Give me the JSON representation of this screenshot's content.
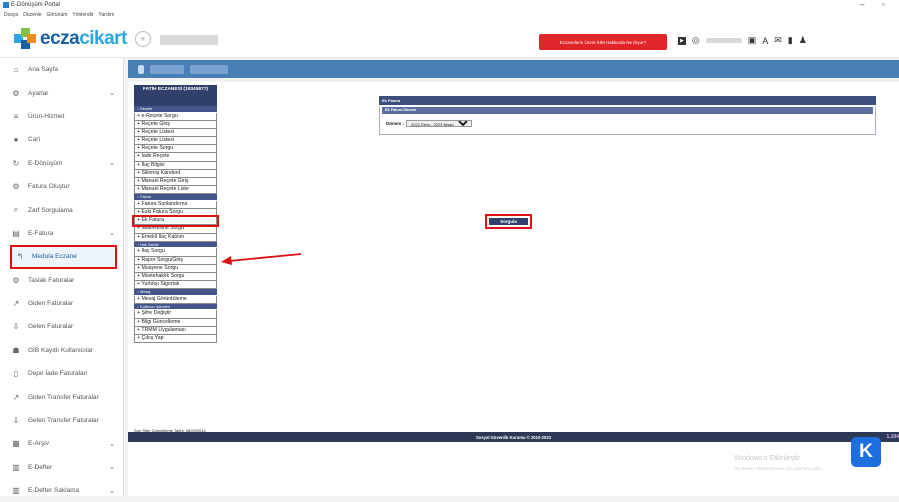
{
  "window": {
    "title": "E-Dönüşüm Portal"
  },
  "menubar": [
    "Dosya",
    "Düzenle",
    "Görünüm",
    "Yönlendir",
    "Yardım"
  ],
  "brand": {
    "name_part1": "ecza",
    "name_part2": "cikart",
    "circle_icon": "plus-circle-icon"
  },
  "alert_button": "Eczanelerin Ücret İHM Hakkında Ne Diyor?",
  "sidebar": [
    {
      "label": "Ana Sayfa",
      "icon": "home-icon"
    },
    {
      "label": "Ayarlar",
      "icon": "gear-icon",
      "chevron": true
    },
    {
      "label": "Ürün-Hizmet",
      "icon": "list-icon"
    },
    {
      "label": "Cari",
      "icon": "user-icon"
    },
    {
      "label": "E-Dönüşüm",
      "icon": "refresh-icon",
      "chevron": true
    },
    {
      "label": "Fatura Oluştur",
      "icon": "gear-icon"
    },
    {
      "label": "Zarf Sorgulama",
      "icon": "search-icon"
    },
    {
      "label": "E-Fatura",
      "icon": "invoice-icon",
      "chevron": true
    },
    {
      "label": "Medula Eczane",
      "icon": "arrow-left-icon",
      "active": true
    },
    {
      "label": "Taslak Faturalar",
      "icon": "gear-icon"
    },
    {
      "label": "Giden Faturalar",
      "icon": "outgoing-icon"
    },
    {
      "label": "Gelen Faturalar",
      "icon": "incoming-icon"
    },
    {
      "label": "GİB Kayıtlı Kullanıcılar",
      "icon": "users-icon"
    },
    {
      "label": "Depo İade Faturaları",
      "icon": "document-icon"
    },
    {
      "label": "Giden Transfer Faturalar",
      "icon": "outgoing-icon"
    },
    {
      "label": "Gelen Transfer Faturalar",
      "icon": "incoming-icon"
    },
    {
      "label": "E-Arşiv",
      "icon": "archive-icon",
      "chevron": true
    },
    {
      "label": "E-Defter",
      "icon": "book-icon",
      "chevron": true
    },
    {
      "label": "E-Defter Saklama",
      "icon": "book-icon",
      "chevron": true
    }
  ],
  "medula": {
    "header": "FATİH ECZANESİ (18345877)",
    "sections": [
      {
        "title": ":: Reçete",
        "links": [
          "+ e-Reçete Sorgu",
          "+ Reçete Giriş",
          "+ Reçete Listesi",
          "+ Reçete Listesi",
          "+ Reçete Sorgu",
          "+ İade Reçete",
          "+ İlaç Bilgisi",
          "+ Silinmiş Karekod",
          "+ Manuel Reçete Giriş",
          "+ Manuel Reçete Liste"
        ]
      },
      {
        "title": ":: Fatura",
        "links": [
          "+ Fatura Sonlandırma",
          "+ Eski Fatura Sorgu",
          "+ Ek Fatura",
          "+ İade/Kesinti Sorgu",
          "+ Emekli İlaç Katılım"
        ]
      },
      {
        "title": ":: Hak Sahibi",
        "links": [
          "+ İlaç Sorgu",
          "+ Rapor Sorgu/Giriş",
          "+ Muayene Sorgu",
          "+ Müstehaklık Sorgu",
          "+ Yurtdışı Sigortalı"
        ]
      },
      {
        "title": ":: Mesaj",
        "links": [
          "+ Mesaj Görüntüleme"
        ]
      },
      {
        "title": ":: Kullanıcı İşlemleri",
        "links": [
          "+ Şifre Değiştir",
          "+ Bilgi Güncelleme",
          "+ TRMM Uygulaması",
          "+ Çıkış Yap"
        ]
      }
    ],
    "highlighted_link": "+ Ek Fatura",
    "footer": "Son Şifre Güncelleme Tarihi: 06/09/2014"
  },
  "ek_fatura": {
    "title": "Ek Fatura",
    "subtitle": "Ek Fatura Dönem",
    "donem_label": "Dönem :",
    "selected_period": "2022 Ekim - 2023 Nisan",
    "query_button": "Sorgula"
  },
  "footer_bar": "Sosyal Güvenlik Kurumu © 2010-2023",
  "footer_num": "1.104",
  "watermark": {
    "line1": "Windows'u Etkinleştir",
    "line2": "Windows'u etkinleştirmek için Ayarlar'a gidin."
  },
  "badge": "K",
  "colors": {
    "accent_red": "#d11111",
    "nav_blue": "#30406a",
    "brand_blue": "#1b5fa8"
  }
}
